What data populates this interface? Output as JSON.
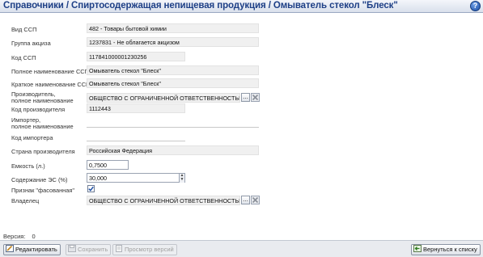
{
  "header": {
    "title": "Справочники / Спиртосодержащая непищевая продукция / Омыватель стекол \"Блеск\"",
    "help_glyph": "?"
  },
  "form": {
    "vid_ssp": {
      "label": "Вид ССП",
      "value": "482 - Товары бытовой химии"
    },
    "gruppa_akciza": {
      "label": "Группа акциза",
      "value": "1237831 - Не облагается акцизом"
    },
    "kod_ssp": {
      "label": "Код ССП",
      "value": "117841000001230256"
    },
    "full_name": {
      "label": "Полное наименование ССП",
      "value": "Омыватель стекол \"Блеск\""
    },
    "short_name": {
      "label": "Краткое наименование ССП",
      "value": "Омыватель стекол \"Блеск\""
    },
    "producer": {
      "label_line1": "Производитель,",
      "label_line2": "полное наименование",
      "value": "ОБЩЕСТВО С ОГРАНИЧЕННОЙ ОТВЕТСТВЕННОСТЬЮ \"КОС"
    },
    "producer_code": {
      "label": "Код производителя",
      "value": "1112443"
    },
    "importer": {
      "label_line1": "Импортер,",
      "label_line2": "полное наименование",
      "value": ""
    },
    "importer_code": {
      "label": "Код импортера",
      "value": ""
    },
    "country": {
      "label": "Страна производителя",
      "value": "Российская Федерация"
    },
    "capacity": {
      "label": "Емкость (л.)",
      "value": "0,7500"
    },
    "es_content": {
      "label": "Содержание ЭС (%)",
      "value": "30,000"
    },
    "packaged": {
      "label": "Признак \"фасованная\"",
      "checked": true
    },
    "owner": {
      "label": "Владелец",
      "value": "ОБЩЕСТВО С ОГРАНИЧЕННОЙ ОТВЕТСТВЕННОСТЬЮ \"КОС"
    },
    "lookup_glyph": "...",
    "spin_up": "▲",
    "spin_down": "▼"
  },
  "version": {
    "label": "Версия:",
    "value": "0"
  },
  "footer": {
    "edit": "Редактировать",
    "save": "Сохранить",
    "view_versions": "Просмотр версий",
    "back": "Вернуться к списку"
  },
  "colors": {
    "title_text": "#1d3f86",
    "title_bar": "#d9e0ec",
    "readonly_field": "#f0f0f0",
    "footer": "#e9ebef",
    "check_mark": "#1d4fa6"
  },
  "icons": {
    "help": "help-icon",
    "lookup": "ellipsis-icon",
    "clear": "clear-x-icon",
    "edit": "pencil-icon",
    "save": "floppy-icon",
    "versions": "document-icon",
    "back": "back-arrow-icon"
  }
}
